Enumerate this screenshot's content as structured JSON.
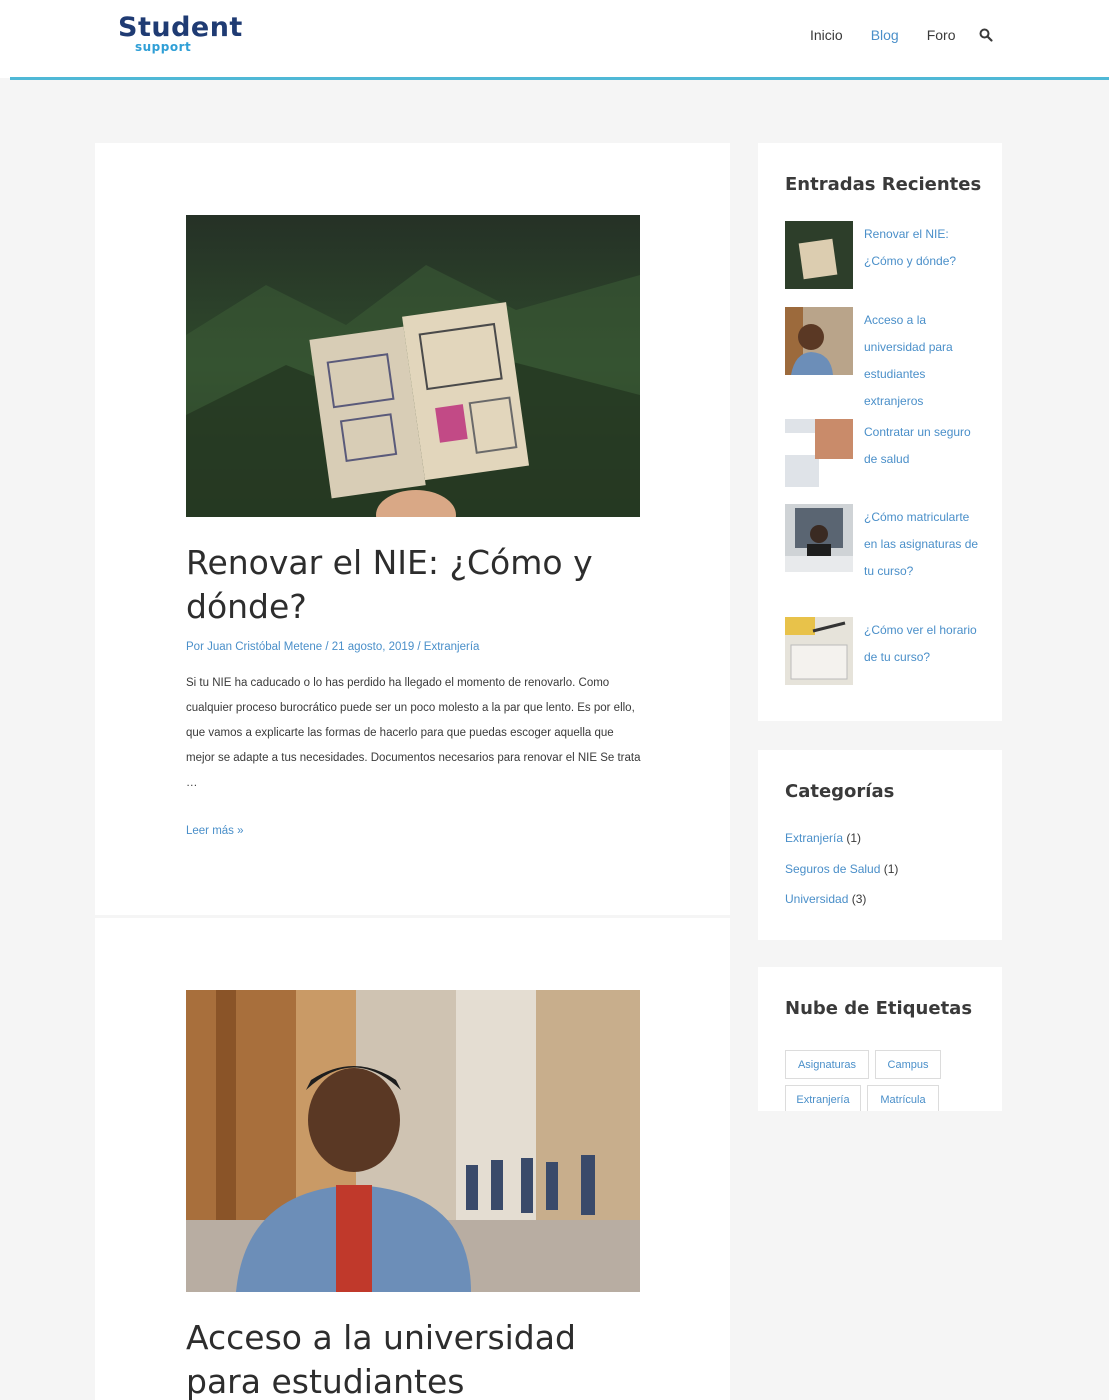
{
  "site": {
    "logo_main": "Student",
    "logo_sub": "support"
  },
  "nav": {
    "items": [
      {
        "label": "Inicio"
      },
      {
        "label": "Blog"
      },
      {
        "label": "Foro"
      }
    ]
  },
  "posts": [
    {
      "title": "Renovar el NIE: ¿Cómo y dónde?",
      "meta": "Por Juan Cristóbal Metene / 21 agosto, 2019 / Extranjería",
      "excerpt": "Si tu NIE ha caducado o lo has perdido ha llegado el momento de renovarlo. Como cualquier proceso burocrático puede ser un poco molesto a la par que lento. Es por ello, que vamos a explicarte las formas de hacerlo para que puedas escoger aquella que mejor se adapte a tus necesidades. Documentos necesarios para renovar el NIE Se trata …",
      "read_more": "Leer más »"
    },
    {
      "title": "Acceso a la universidad para estudiantes extranjeros"
    }
  ],
  "sidebar": {
    "recent_title": "Entradas Recientes",
    "recent": [
      {
        "label": "Renovar el NIE: ¿Cómo y dónde?"
      },
      {
        "label": "Acceso a la universidad para estudiantes extranjeros"
      },
      {
        "label": "Contratar un seguro de salud"
      },
      {
        "label": "¿Cómo matricularte en las asignaturas de tu curso?"
      },
      {
        "label": "¿Cómo ver el horario de tu curso?"
      }
    ],
    "categories_title": "Categorías",
    "categories": [
      {
        "label": "Extranjería",
        "count": "(1)"
      },
      {
        "label": "Seguros de Salud",
        "count": "(1)"
      },
      {
        "label": "Universidad",
        "count": "(3)"
      }
    ],
    "tags_title": "Nube de Etiquetas",
    "tags": [
      {
        "label": "Asignaturas"
      },
      {
        "label": "Campus"
      },
      {
        "label": "Extranjería"
      },
      {
        "label": "Matrícula"
      }
    ]
  },
  "colors": {
    "accent": "#4a8fc9",
    "header_line": "#4fb8d6",
    "logo_dark": "#1f3b73",
    "logo_light": "#2f9fd6"
  }
}
